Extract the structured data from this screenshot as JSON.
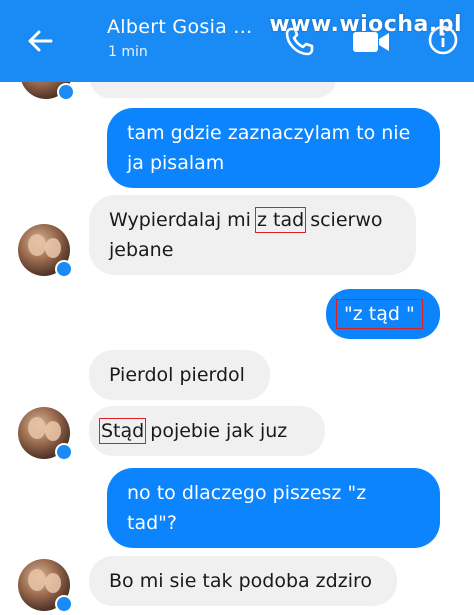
{
  "header": {
    "title": "Albert Gosia ...",
    "subtitle": "1 min",
    "watermark": "www.wiocha.pl",
    "icons": [
      "back-arrow-icon",
      "phone-icon",
      "video-camera-icon",
      "info-icon"
    ],
    "color": "#1a8bf5"
  },
  "messages": [
    {
      "from": "them",
      "text": ""
    },
    {
      "from": "me",
      "line1": "tam gdzie zaznaczylam to nie",
      "line2": "ja pisalam"
    },
    {
      "from": "them",
      "pre": "Wypierdalaj mi ",
      "mark": "z tad",
      "post": " scierwo",
      "line2": "jebane"
    },
    {
      "from": "me",
      "text": "\"z tąd \""
    },
    {
      "from": "them",
      "text": "Pierdol pierdol"
    },
    {
      "from": "them",
      "mark": "Stąd",
      "post": " pojebie jak juz"
    },
    {
      "from": "me",
      "line1": "no to dlaczego piszesz \"z",
      "line2": "tad\"?"
    },
    {
      "from": "them",
      "text": "Bo mi sie tak podoba zdziro"
    }
  ],
  "colors": {
    "outgoing": "#0b84fe",
    "incoming": "#f1f0f0",
    "highlight": "#e02020"
  }
}
